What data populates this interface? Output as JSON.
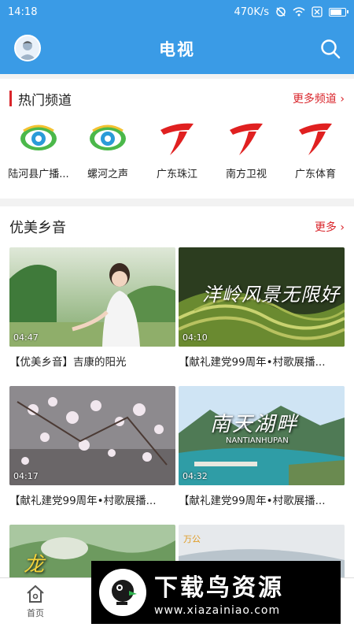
{
  "status_bar": {
    "time": "14:18",
    "net_speed": "470K/s",
    "icons": [
      "alarm-off-icon",
      "wifi-icon",
      "sim-error-icon",
      "battery-icon"
    ]
  },
  "app_bar": {
    "title": "电视",
    "left_icon": "avatar",
    "right_icon": "search-icon",
    "color": "#3a9be6"
  },
  "hot_channels": {
    "title": "热门频道",
    "more": "更多频道 ›",
    "accent": "#d9252b",
    "items": [
      {
        "label": "陆河县广播...",
        "logo": "eye-logo"
      },
      {
        "label": "螺河之声",
        "logo": "eye-logo"
      },
      {
        "label": "广东珠江",
        "logo": "gdtv-logo"
      },
      {
        "label": "南方卫视",
        "logo": "gdtv-logo"
      },
      {
        "label": "广东体育",
        "logo": "gdtv-logo"
      }
    ]
  },
  "music_section": {
    "title": "优美乡音",
    "more": "更多 ›",
    "videos": [
      {
        "title": "【优美乡音】吉康的阳光",
        "duration": "04:47"
      },
      {
        "title": "【献礼建党99周年•村歌展播...",
        "duration": "04:10",
        "overlay": "洋岭风景无限好"
      },
      {
        "title": "【献礼建党99周年•村歌展播...",
        "duration": "04:17"
      },
      {
        "title": "【献礼建党99周年•村歌展播...",
        "duration": "04:32",
        "overlay": "南天湖畔",
        "overlay_sub": "NANTIANHUPAN"
      },
      {
        "title": "",
        "duration": "",
        "overlay": "龙"
      },
      {
        "title": "",
        "duration": "",
        "overlay": "万公"
      }
    ]
  },
  "bottom_nav": {
    "home_label": "首页"
  },
  "watermark": {
    "text": "下载鸟资源",
    "url": "www.xiazainiao.com"
  }
}
